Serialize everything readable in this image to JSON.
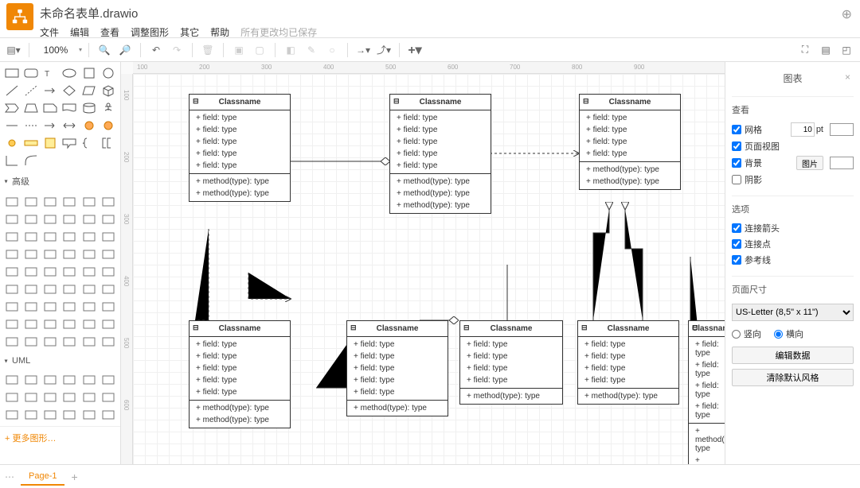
{
  "header": {
    "title": "未命名表单.drawio",
    "menu": [
      "文件",
      "编辑",
      "查看",
      "调整图形",
      "其它",
      "帮助"
    ],
    "saved": "所有更改均已保存"
  },
  "toolbar": {
    "zoom": "100%"
  },
  "sidebar": {
    "sections": {
      "adv": "高级",
      "uml": "UML"
    },
    "more": "+ 更多图形…"
  },
  "uml": {
    "classname": "Classname",
    "field": "+ field: type",
    "method": "+ method(type): type"
  },
  "panel": {
    "title": "图表",
    "view": "查看",
    "grid": "网格",
    "pageview": "页面视图",
    "background": "背景",
    "shadow": "阴影",
    "pt_label": "pt",
    "pt_value": "10",
    "image_btn": "图片",
    "options": "选项",
    "arrow": "连接箭头",
    "conn": "连接点",
    "guide": "参考线",
    "pagesize": "页面尺寸",
    "size_sel": "US-Letter (8,5\" x 11\")",
    "portrait": "竖向",
    "landscape": "横向",
    "editdata": "编辑数据",
    "cleardef": "清除默认风格"
  },
  "tabs": {
    "page1": "Page-1"
  },
  "ruler_h": [
    "100",
    "200",
    "300",
    "400",
    "500",
    "600",
    "700",
    "800",
    "900"
  ],
  "ruler_v": [
    "100",
    "200",
    "300",
    "400",
    "500",
    "600"
  ]
}
